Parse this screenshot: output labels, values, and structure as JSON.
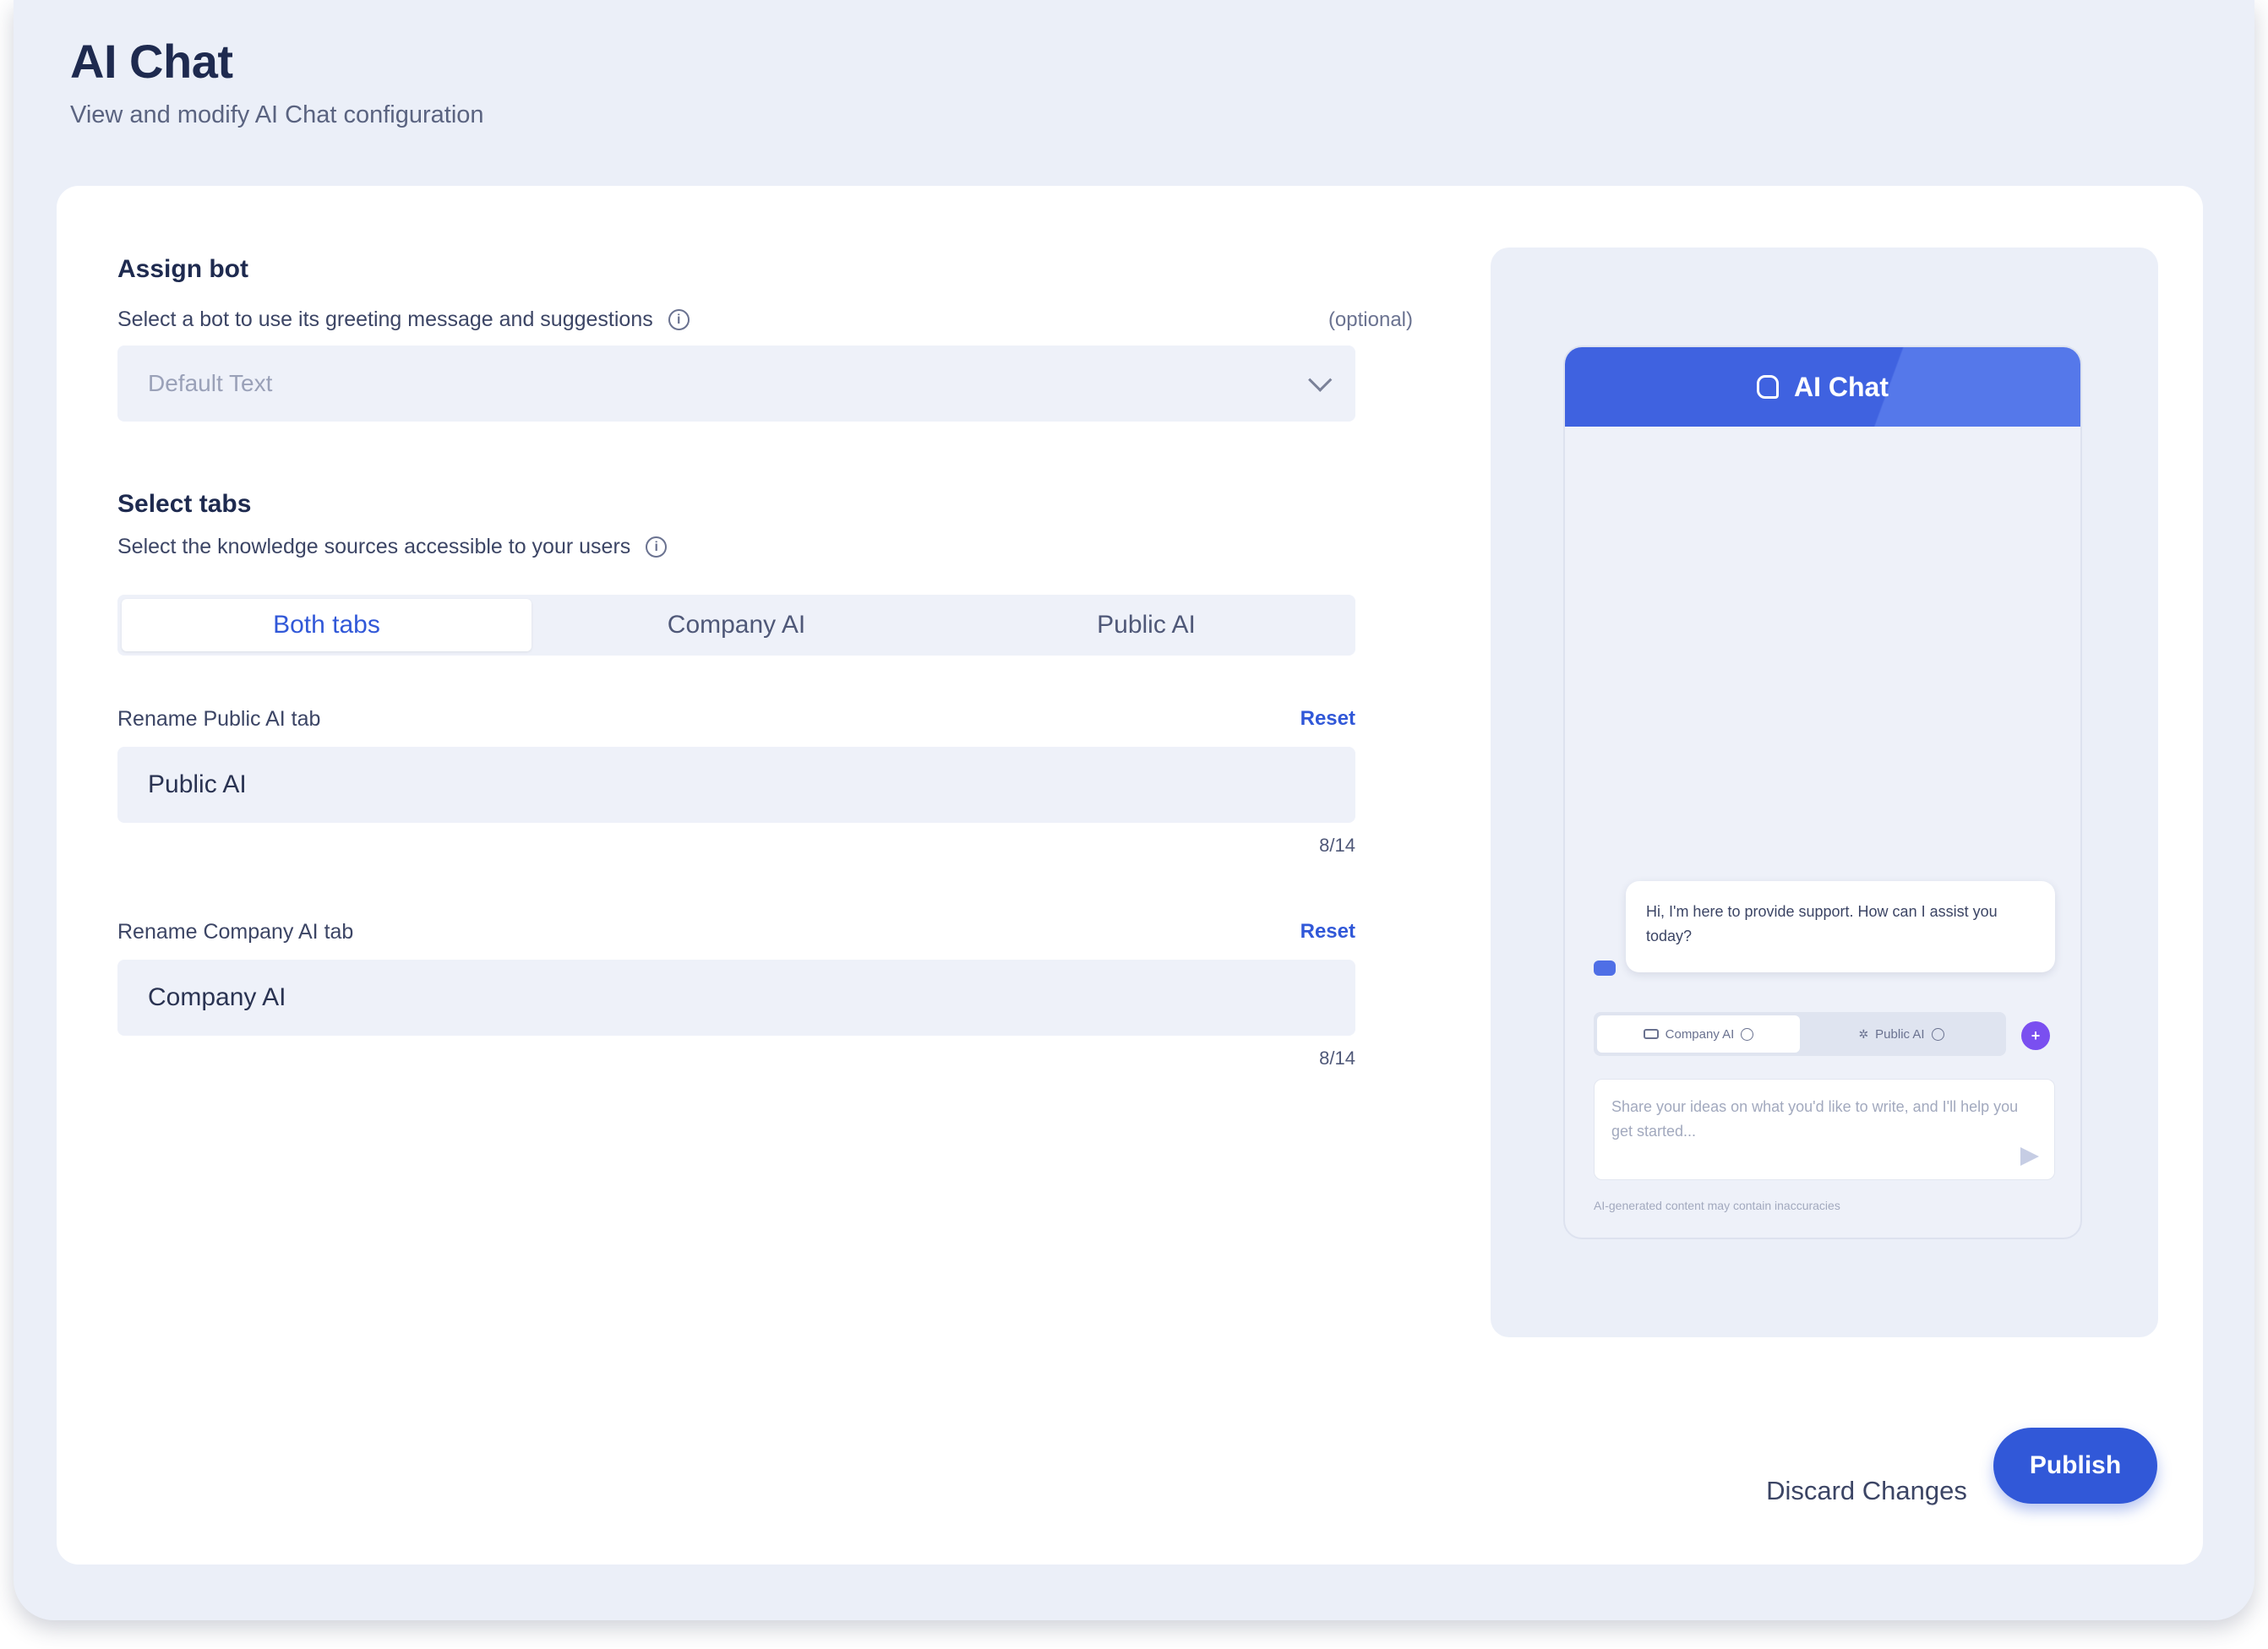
{
  "page": {
    "title": "AI Chat",
    "subtitle": "View and modify AI Chat configuration"
  },
  "assign_bot": {
    "heading": "Assign bot",
    "helper": "Select a bot to use its greeting message and suggestions",
    "optional": "(optional)",
    "select_value": "Default Text"
  },
  "select_tabs": {
    "heading": "Select tabs",
    "helper": "Select the knowledge sources accessible to your users",
    "tabs": [
      {
        "label": "Both tabs",
        "active": true
      },
      {
        "label": "Company AI",
        "active": false
      },
      {
        "label": "Public AI",
        "active": false
      }
    ]
  },
  "rename_public": {
    "label": "Rename Public AI tab",
    "reset": "Reset",
    "value": "Public AI",
    "count": "8/14"
  },
  "rename_company": {
    "label": "Rename Company AI tab",
    "reset": "Reset",
    "value": "Company AI",
    "count": "8/14"
  },
  "preview": {
    "header_title": "AI Chat",
    "greeting": "Hi, I'm here to provide support. How can I assist you today?",
    "tabs": [
      "Company AI",
      "Public AI"
    ],
    "input_placeholder": "Share your ideas on what you'd like to write, and I'll help you get started...",
    "disclaimer": "AI-generated content may contain inaccuracies"
  },
  "actions": {
    "discard": "Discard Changes",
    "publish": "Publish"
  },
  "colors": {
    "accent": "#3158d8",
    "preview_header": "#3f62e0",
    "magic_button": "#7a4ff0"
  }
}
